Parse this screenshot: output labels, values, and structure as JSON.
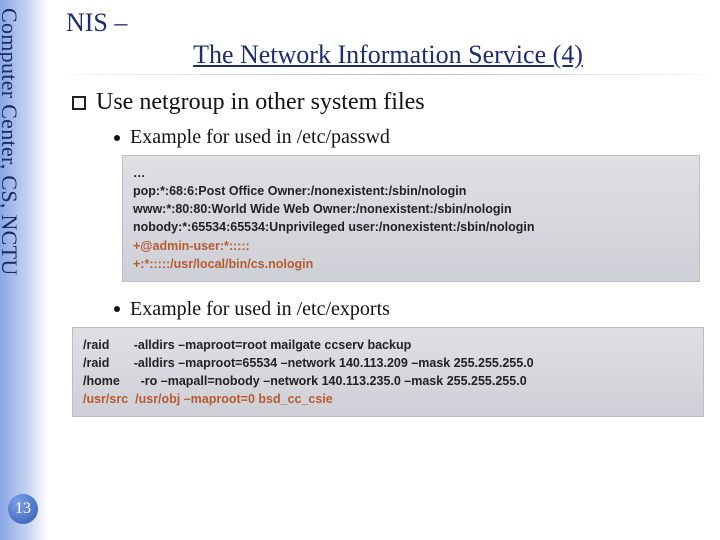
{
  "rail": {
    "label": "Computer Center, CS, NCTU"
  },
  "page_number": "13",
  "title": {
    "prefix": "NIS –",
    "main": "The Network Information Service (4)"
  },
  "heading": "Use netgroup in other system files",
  "bullets": {
    "passwd_label": "Example for used in /etc/passwd",
    "exports_label": "Example for used in /etc/exports"
  },
  "passwd_lines": {
    "l0": "…",
    "l1": "pop:*:68:6:Post Office Owner:/nonexistent:/sbin/nologin",
    "l2": "www:*:80:80:World Wide Web Owner:/nonexistent:/sbin/nologin",
    "l3": "nobody:*:65534:65534:Unprivileged user:/nonexistent:/sbin/nologin",
    "l4": "+@admin-user:*:::::",
    "l5": "+:*:::::/usr/local/bin/cs.nologin"
  },
  "exports_lines": {
    "l0": "/raid       -alldirs –maproot=root mailgate ccserv backup",
    "l1": "/raid       -alldirs –maproot=65534 –network 140.113.209 –mask 255.255.255.0",
    "l2": "/home      -ro –mapall=nobody –network 140.113.235.0 –mask 255.255.255.0",
    "l3": "/usr/src  /usr/obj –maproot=0 bsd_cc_csie"
  }
}
